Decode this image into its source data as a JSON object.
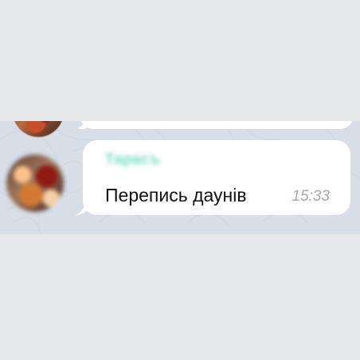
{
  "chat": {
    "message": {
      "sender": "Тарасъ",
      "text": "Перепись даунів",
      "time": "15:33"
    }
  },
  "colors": {
    "page_background": "#e6e7e9",
    "chat_background": "#d7dee7",
    "bubble": "#ffffff",
    "sender_name": "#63d7b8",
    "message_text": "#111111",
    "timestamp": "#a7a9ac"
  },
  "icons": {
    "avatar": "avatar",
    "previous_avatar": "avatar",
    "wallpaper": "chat-wallpaper-pattern"
  }
}
